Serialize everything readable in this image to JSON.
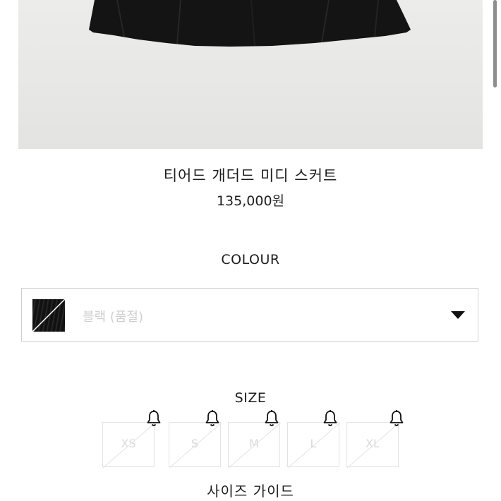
{
  "product": {
    "name": "티어드 개더드 미디 스커트",
    "price": "135,000원"
  },
  "colour": {
    "label": "COLOUR",
    "selected": "블랙 (품절)"
  },
  "size": {
    "label": "SIZE",
    "options": [
      "XS",
      "S",
      "M",
      "L",
      "XL"
    ]
  },
  "size_guide_label": "사이즈 가이드",
  "colors": {
    "hero_bg": "#e8e8e6",
    "skirt": "#141414",
    "border": "#cfcfcf",
    "disabled_text": "#cfcfcf"
  },
  "icons": {
    "dropdown": "chevron-down-icon",
    "restock_alert": "bell-icon"
  }
}
